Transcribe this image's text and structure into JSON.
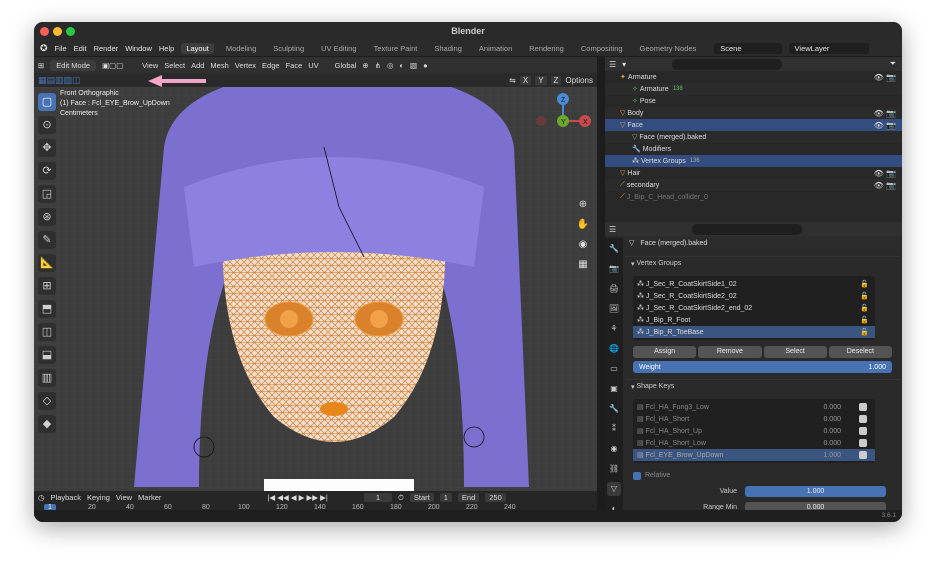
{
  "app_title": "Blender",
  "menu": [
    "File",
    "Edit",
    "Render",
    "Window",
    "Help"
  ],
  "workspaces": [
    "Layout",
    "Modeling",
    "Sculpting",
    "UV Editing",
    "Texture Paint",
    "Shading",
    "Animation",
    "Rendering",
    "Compositing",
    "Geometry Nodes"
  ],
  "scene": "Scene",
  "view_layer": "ViewLayer",
  "viewport_header": {
    "mode": "Edit Mode",
    "items": [
      "View",
      "Select",
      "Add",
      "Mesh",
      "Vertex",
      "Edge",
      "Face",
      "UV"
    ],
    "transform": "Global",
    "options": "Options"
  },
  "axis_buttons": [
    "X",
    "Y",
    "Z"
  ],
  "overlay": {
    "line1": "Front Orthographic",
    "line2": "(1) Face : Fcl_EYE_Brow_UpDown",
    "line3": "Centimeters"
  },
  "gizmo": {
    "x": "X",
    "y": "Y",
    "z": "Z"
  },
  "timeline": {
    "menus": [
      "Playback",
      "Keying",
      "View",
      "Marker"
    ],
    "current_frame": "1",
    "start_label": "Start",
    "start": "1",
    "end_label": "End",
    "end": "250",
    "ruler": [
      "1",
      "20",
      "40",
      "60",
      "80",
      "100",
      "120",
      "140",
      "160",
      "180",
      "200",
      "220",
      "240"
    ]
  },
  "outliner": [
    {
      "name": "Armature",
      "indent": 0,
      "icon": "armature-icon"
    },
    {
      "name": "Armature",
      "indent": 1,
      "badge": "138"
    },
    {
      "name": "Pose",
      "indent": 1
    },
    {
      "name": "Body",
      "indent": 0
    },
    {
      "name": "Face",
      "indent": 0,
      "selected": true
    },
    {
      "name": "Face (merged).baked",
      "indent": 1
    },
    {
      "name": "Modifiers",
      "indent": 1
    },
    {
      "name": "Vertex Groups",
      "indent": 1,
      "selected": true,
      "badge": "136"
    },
    {
      "name": "Hair",
      "indent": 0
    },
    {
      "name": "secondary",
      "indent": 0
    },
    {
      "name": "J_Bip_C_Head_collider_0",
      "indent": 0
    }
  ],
  "properties": {
    "object_name": "Face (merged).baked",
    "vertex_groups_title": "Vertex Groups",
    "vertex_groups": [
      "J_Sec_R_CoatSkirtSide1_02",
      "J_Sec_R_CoatSkirtSide2_02",
      "J_Sec_R_CoatSkirtSide2_end_02",
      "J_Bip_R_Foot",
      "J_Bip_R_ToeBase"
    ],
    "buttons": [
      "Assign",
      "Remove",
      "Select",
      "Deselect"
    ],
    "weight_label": "Weight",
    "weight_value": "1.000",
    "shape_keys_title": "Shape Keys",
    "shape_keys": [
      {
        "name": "Fcl_HA_Fung3_Low",
        "value": "0.000"
      },
      {
        "name": "Fcl_HA_Short",
        "value": "0.000"
      },
      {
        "name": "Fcl_HA_Short_Up",
        "value": "0.000"
      },
      {
        "name": "Fcl_HA_Short_Low",
        "value": "0.000"
      },
      {
        "name": "Fcl_EYE_Brow_UpDown",
        "value": "1.000"
      }
    ],
    "relative": "Relative",
    "value_label": "Value",
    "value": "1.000",
    "range_min_label": "Range Min",
    "range_min": "0.000"
  },
  "version": "3.6.1",
  "colors": {
    "accent": "#4772b3",
    "mesh": "#e8861c",
    "hair": "#7b6fd0",
    "arrow": "#f4a6c6"
  }
}
